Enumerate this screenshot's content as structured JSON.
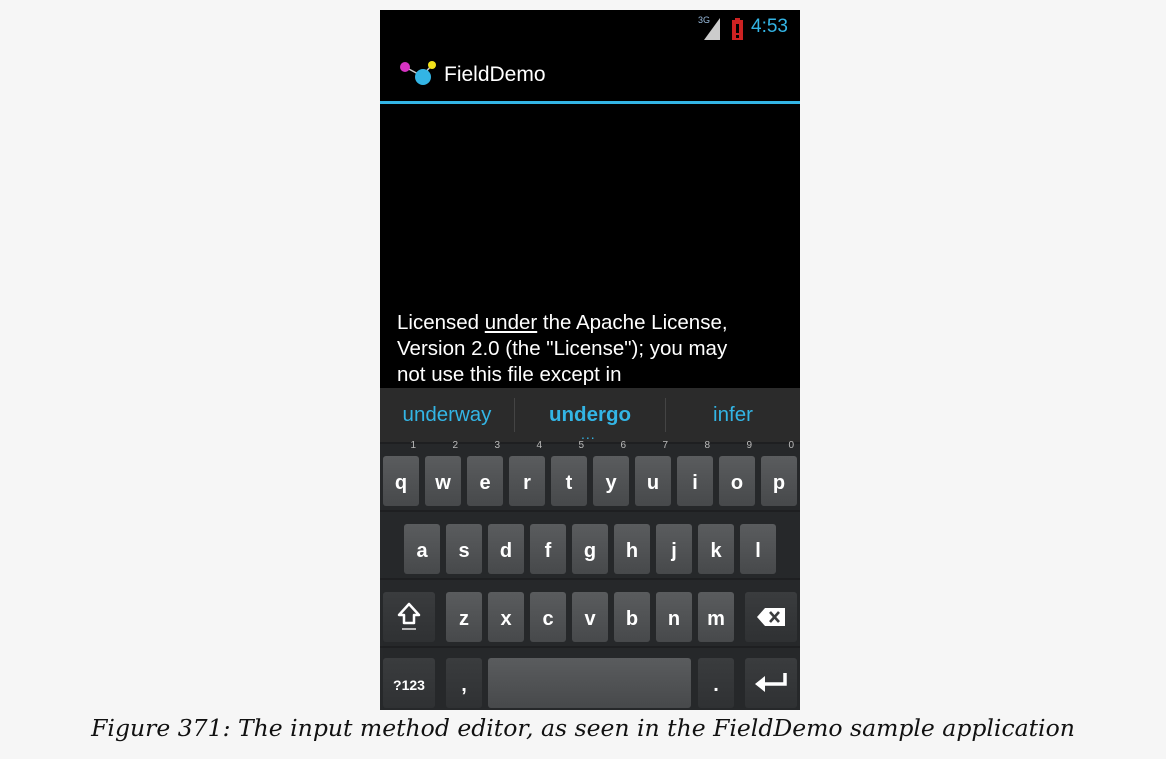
{
  "status_bar": {
    "network": "3G",
    "time": "4:53"
  },
  "app": {
    "title": "FieldDemo"
  },
  "editor": {
    "line1_pre": "Licensed ",
    "line1_under": "under",
    "line1_post": " the Apache License,",
    "line2": "Version 2.0 (the \"License\"); you may",
    "line3": "not use this file except in"
  },
  "suggestions": [
    "underway",
    "undergo",
    "infer"
  ],
  "keyboard": {
    "row1": [
      {
        "key": "q",
        "hint": "1"
      },
      {
        "key": "w",
        "hint": "2"
      },
      {
        "key": "e",
        "hint": "3"
      },
      {
        "key": "r",
        "hint": "4"
      },
      {
        "key": "t",
        "hint": "5"
      },
      {
        "key": "y",
        "hint": "6"
      },
      {
        "key": "u",
        "hint": "7"
      },
      {
        "key": "i",
        "hint": "8"
      },
      {
        "key": "o",
        "hint": "9"
      },
      {
        "key": "p",
        "hint": "0"
      }
    ],
    "row2": [
      "a",
      "s",
      "d",
      "f",
      "g",
      "h",
      "j",
      "k",
      "l"
    ],
    "row3": [
      "z",
      "x",
      "c",
      "v",
      "b",
      "n",
      "m"
    ],
    "symbols_label": "?123",
    "comma_label": ",",
    "period_label": ".",
    "more_hint": "..."
  },
  "caption": "Figure 371: The input method editor, as seen in the FieldDemo sample application"
}
